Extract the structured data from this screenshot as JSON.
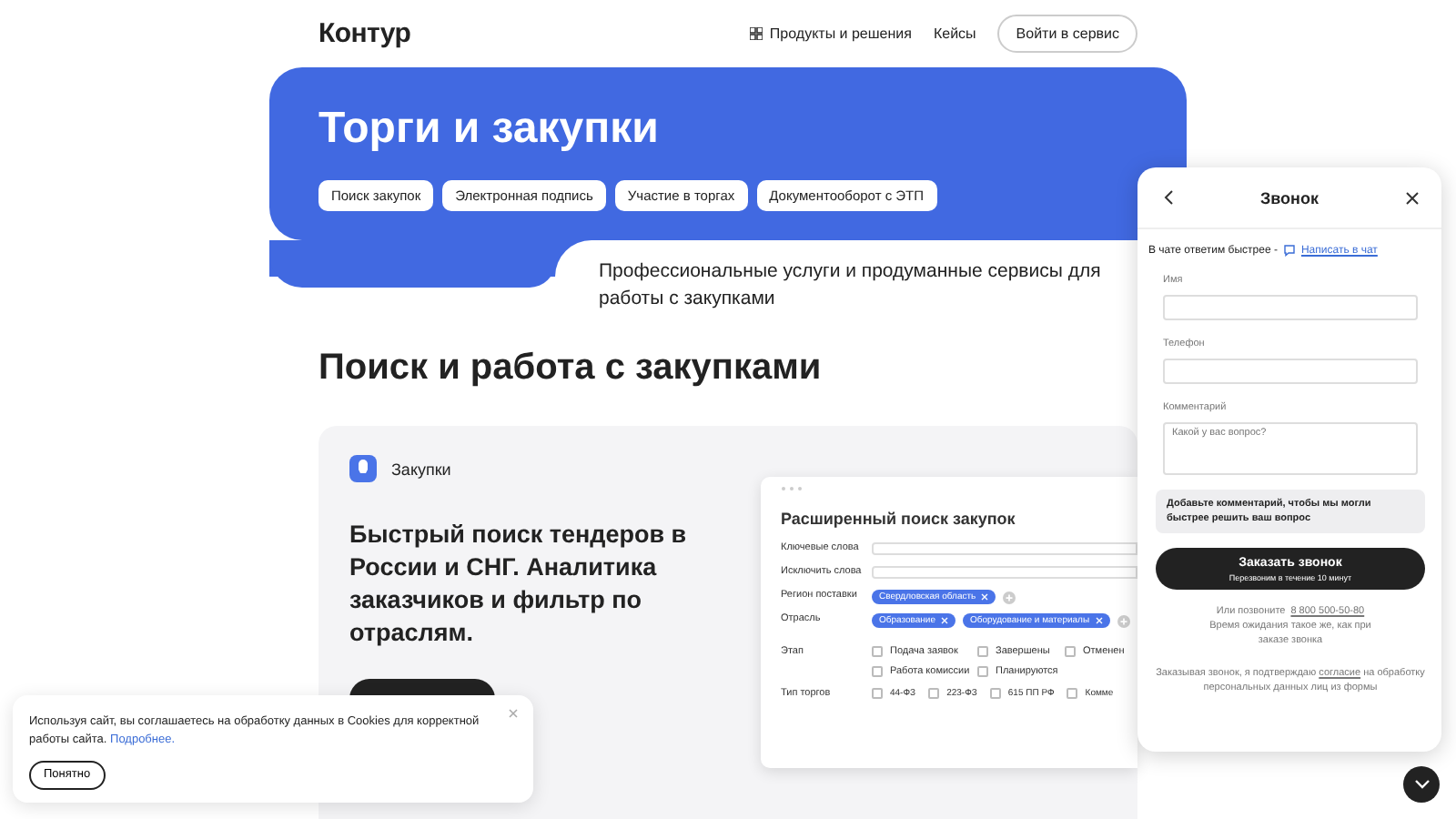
{
  "header": {
    "logo": "Контур",
    "nav": [
      "Продукты и решения",
      "Кейсы"
    ],
    "login": "Войти в сервис"
  },
  "hero": {
    "title": "Торги и закупки",
    "tabs": [
      "Поиск закупок",
      "Электронная подпись",
      "Участие в торгах",
      "Документооборот с ЭТП"
    ],
    "subtitle": "Профессиональные услуги и продуманные сервисы для работы с закупками"
  },
  "section": {
    "title": "Поиск и работа с закупками"
  },
  "card": {
    "product": "Закупки",
    "headline": "Быстрый поиск тендеров в России и СНГ. Аналитика заказчиков и фильтр по отраслям."
  },
  "mockup": {
    "title": "Расширенный поиск закупок",
    "fields": [
      {
        "kind": "input",
        "label": "Ключевые слова"
      },
      {
        "kind": "input",
        "label": "Исключить слова"
      },
      {
        "kind": "chips",
        "label": "Регион поставки",
        "chips": [
          "Свердловская область"
        ]
      },
      {
        "kind": "chips",
        "label": "Отрасль",
        "chips": [
          "Образование",
          "Оборудование и материалы"
        ]
      },
      {
        "kind": "checks",
        "label": "Этап",
        "options": [
          {
            "label": "Подача заявок",
            "checked": false
          },
          {
            "label": "Завершены",
            "checked": false
          },
          {
            "label": "Отменен",
            "checked": false
          },
          {
            "label": "Работа комиссии",
            "checked": false
          },
          {
            "label": "Планируются",
            "checked": false
          }
        ]
      },
      {
        "kind": "checks",
        "label": "Тип торгов",
        "options": [
          {
            "label": "44-ФЗ",
            "checked": false
          },
          {
            "label": "223-ФЗ",
            "checked": false
          },
          {
            "label": "615 ПП РФ",
            "checked": false
          },
          {
            "label": "Комме",
            "checked": false
          }
        ]
      }
    ]
  },
  "call_panel": {
    "title": "Звонок",
    "chat_note": "В чате ответим быстрее -",
    "chat_link": "Написать в чат",
    "fields": [
      {
        "kind": "input",
        "label": "Имя"
      },
      {
        "kind": "input",
        "label": "Телефон"
      },
      {
        "kind": "textarea",
        "label": "Комментарий",
        "placeholder": "Какой у вас вопрос?"
      }
    ],
    "hint": "Добавьте комментарий, чтобы мы могли быстрее решить ваш вопрос",
    "button": "Заказать звонок",
    "button_sub": "Перезвоним в течение 10 минут",
    "phone_note": "Или позвоните",
    "phone": "8 800 500-50-80",
    "wait_note": "Время ожидания такое же, как при заказе звонка",
    "consent_pre": "Заказывая звонок, я подтверждаю",
    "consent_link": "согласие",
    "consent_post": "на обработку персональных данных лиц из формы"
  },
  "cookie": {
    "text": "Используя сайт, вы соглашаетесь на обработку данных в Cookies для корректной работы сайта.",
    "link": "Подробнее.",
    "button": "Понятно"
  }
}
